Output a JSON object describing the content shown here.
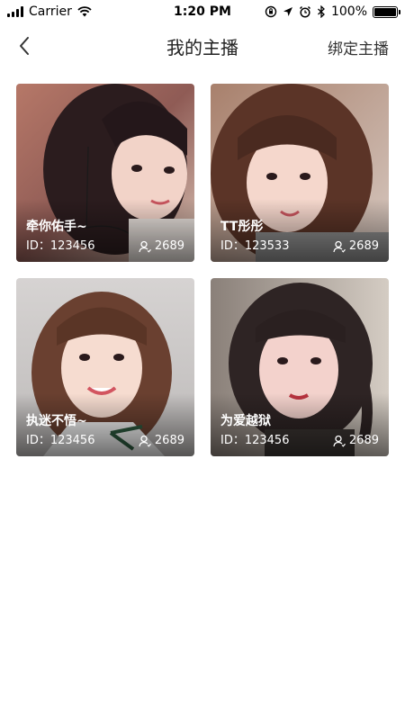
{
  "status_bar": {
    "carrier": "Carrier",
    "time": "1:20 PM",
    "battery": "100%"
  },
  "nav": {
    "title": "我的主播",
    "action": "绑定主播"
  },
  "anchors": [
    {
      "name": "牵你佑手~",
      "id": "ID：123456",
      "fans": "2689"
    },
    {
      "name": "TT彤彤",
      "id": "ID：123533",
      "fans": "2689"
    },
    {
      "name": "执迷不悟~",
      "id": "ID：123456",
      "fans": "2689"
    },
    {
      "name": "为爱越狱",
      "id": "ID：123456",
      "fans": "2689"
    }
  ]
}
